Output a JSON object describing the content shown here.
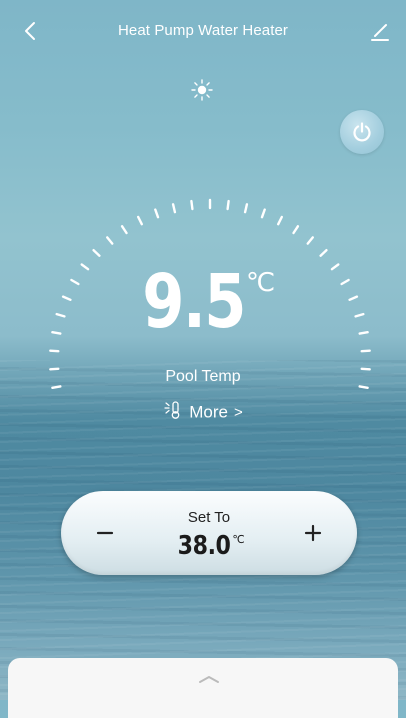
{
  "header": {
    "title": "Heat Pump Water Heater",
    "back_icon": "chevron-left-icon",
    "edit_icon": "edit-icon"
  },
  "mode_icon": "sun-icon",
  "power_icon": "power-icon",
  "current_temp": {
    "value": "9.5",
    "unit": "℃",
    "label": "Pool Temp"
  },
  "more": {
    "label": "More",
    "icon": "thermometer-icon",
    "chevron": ">"
  },
  "setpoint": {
    "label": "Set To",
    "value": "38.0",
    "unit": "℃",
    "minus_icon": "minus-icon",
    "plus_icon": "plus-icon"
  },
  "bottom_sheet": {
    "handle_icon": "chevron-up-icon"
  },
  "colors": {
    "sky_top": "#7fb6c8",
    "sea": "#4f8aa1",
    "text_light": "#ffffff",
    "pill_bg": "#f3f8fa"
  }
}
